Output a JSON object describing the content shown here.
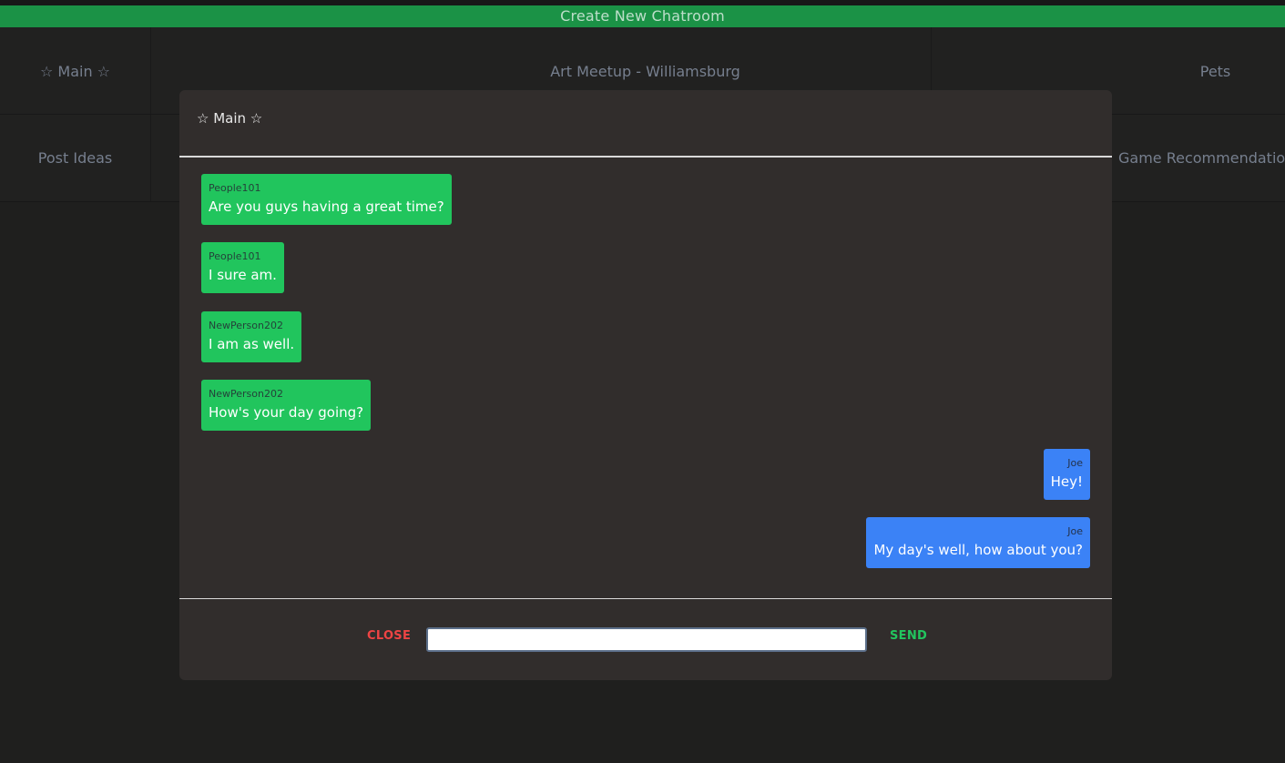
{
  "header": {
    "create_label": "Create New Chatroom"
  },
  "rooms": [
    {
      "label": "☆ Main ☆"
    },
    {
      "label": "Art Meetup - Williamsburg"
    },
    {
      "label": "Pets"
    },
    {
      "label": "Post Ideas"
    },
    {
      "label": "Game Recommendations"
    }
  ],
  "modal": {
    "title": "☆ Main ☆",
    "messages": [
      {
        "author": "People101",
        "text": "Are you guys having a great time?",
        "side": "left"
      },
      {
        "author": "People101",
        "text": "I sure am.",
        "side": "left"
      },
      {
        "author": "NewPerson202",
        "text": "I am as well.",
        "side": "left"
      },
      {
        "author": "NewPerson202",
        "text": "How's your day going?",
        "side": "left"
      },
      {
        "author": "Joe",
        "text": "Hey!",
        "side": "right"
      },
      {
        "author": "Joe",
        "text": "My day's well, how about you?",
        "side": "right"
      }
    ],
    "close_label": "CLOSE",
    "send_label": "SEND",
    "input_value": "",
    "input_placeholder": ""
  },
  "colors": {
    "header_bar": "#1d9a4a",
    "other_bubble": "#21c55d",
    "own_bubble": "#3b82f6",
    "close": "#ef4444",
    "send": "#22c55e",
    "modal_bg": "#312d2c",
    "page_bg": "#212120"
  }
}
